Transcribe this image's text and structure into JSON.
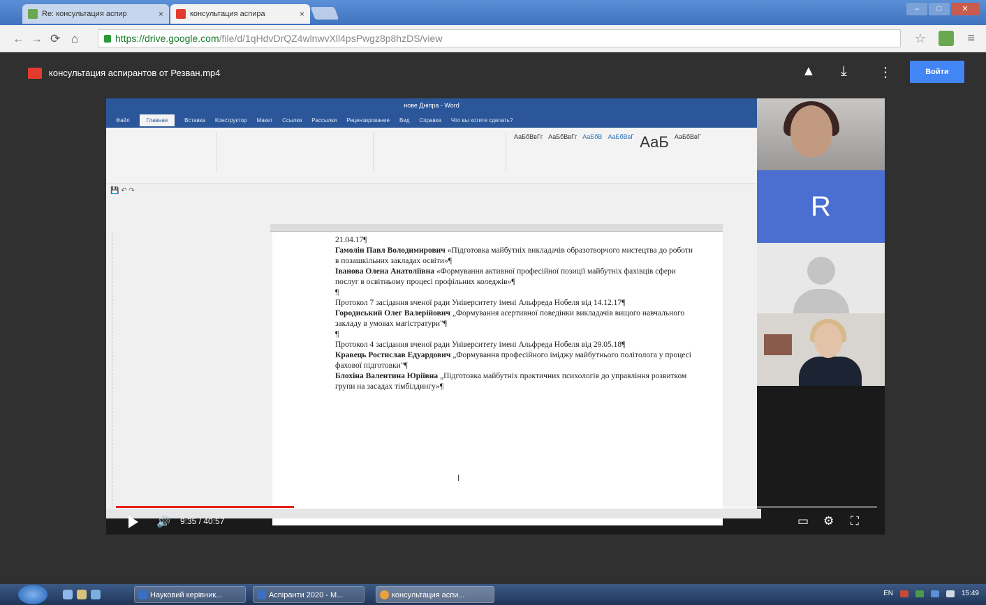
{
  "browser": {
    "tabs": [
      {
        "label": "Re: консультация аспир",
        "close": "×"
      },
      {
        "label": "консультация аспира",
        "close": "×"
      }
    ],
    "url_host": "https://drive.google.com",
    "url_path": "/file/d/1qHdvDrQZ4wlnwvXll4psPwgz8p8hzDS/view"
  },
  "viewer": {
    "filename": "консультация аспирантов от Резван.mp4",
    "signin_label": "Войти",
    "colors": {
      "accent": "#4285f4",
      "progress": "#e62117"
    }
  },
  "word": {
    "title": "нове Дніпра - Word",
    "tabs": [
      "Файл",
      "Главная",
      "Вставка",
      "Конструктор",
      "Макет",
      "Ссылки",
      "Рассылки",
      "Рецензирование",
      "Вид",
      "Справка",
      "Что вы хотите сделать?"
    ],
    "styles": [
      "АаБбВвГг",
      "АаБбВвГг",
      "АаБбВ",
      "АаБбВвГ",
      "АаБ",
      "АаБбВвГ"
    ],
    "document_lines": [
      {
        "text": "21.04.17¶"
      },
      {
        "bold": "Гамолін Павл Володимирович",
        "text": " «Підготовка майбутніх викладачів образотворчого мистецтва до роботи в позашкільних закладах освіти»¶"
      },
      {
        "bold": "Іванова Олена Анатоліївна",
        "text": " «Формування активної професійної позиції майбутніх фахівців сфери послуг в освітньому процесі профільних коледжів»¶"
      },
      {
        "text": "¶"
      },
      {
        "text": "Протокол 7 засідання вченої ради Університету імені Альфреда Нобеля від 14.12.17¶"
      },
      {
        "bold": "Городиський Олег Валерійович",
        "text": " „Формування асертивної поведінки викладачів вищого навчального закладу в умовах магістратури\"¶"
      },
      {
        "text": "¶"
      },
      {
        "text": "Протокол 4 засідання вченої ради Університету імені Альфреда Нобеля від 29.05.18¶"
      },
      {
        "bold": "Кравець Ростислав Едуардович",
        "text": " „Формування професійного іміджу майбутнього політолога у процесі фахової підготовки\"¶"
      },
      {
        "bold": "Блохіна Валентина Юріївна",
        "text": " „Підготовка майбутніх практичних психологів до управління розвитком групи на засадах тімбілдингу»¶"
      }
    ]
  },
  "participants": [
    {
      "name": "participant-woman-1"
    },
    {
      "initial": "R"
    },
    {
      "name": "participant-placeholder"
    },
    {
      "name": "participant-woman-2"
    }
  ],
  "player": {
    "time": "9:35 / 40:57",
    "progress_fraction": 0.234
  },
  "taskbar": {
    "buttons": [
      "Науковий керівник...",
      "Аспіранти 2020 - М...",
      "консультация аспи..."
    ],
    "lang": "EN",
    "clock": "15:49"
  }
}
